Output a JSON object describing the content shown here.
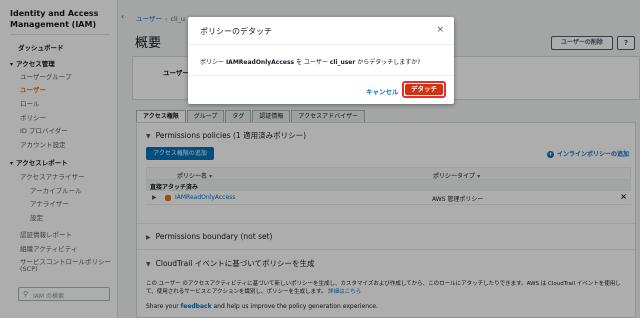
{
  "sidebar": {
    "title_line1": "Identity and Access",
    "title_line2": "Management (IAM)",
    "dashboard": "ダッシュボード",
    "access_mgmt": "アクセス管理",
    "items": [
      "ユーザーグループ",
      "ユーザー",
      "ロール",
      "ポリシー",
      "ID プロバイダー",
      "アカウント設定"
    ],
    "access_reports": "アクセスレポート",
    "reports": [
      "アクセスアナライザー",
      "アーカイブルール",
      "アナライザー",
      "設定"
    ],
    "bottom": [
      "認証情報レポート",
      "組織アクティビティ",
      "サービスコントロールポリシー",
      "(SCP)"
    ],
    "search_placeholder": "IAM の検索"
  },
  "breadcrumb": {
    "item1": "ユーザー",
    "item2": "cli_u"
  },
  "page": {
    "title": "概要",
    "delete_user": "ユーザーの削除",
    "summary_label": "ユーザー"
  },
  "tabs": [
    "アクセス権限",
    "グループ",
    "タグ",
    "認証情報",
    "アクセスアドバイザー"
  ],
  "permissions": {
    "heading": "Permissions policies (1 適用済みポリシー)",
    "add_button": "アクセス権限の追加",
    "inline_add": "インラインポリシーの追加",
    "col_policy": "ポリシー名 ▾",
    "col_type": "ポリシータイプ ▾",
    "group": "直接アタッチ済み",
    "rows": [
      {
        "name": "IAMReadOnlyAccess",
        "type": "AWS 管理ポリシー"
      }
    ]
  },
  "boundary": {
    "heading": "Permissions boundary (not set)"
  },
  "cloudtrail": {
    "heading": "CloudTrail イベントに基づいてポリシーを生成",
    "text": "この ユーザー のアクセスアクティビティに基づいて新しいポリシーを生成し、カスタマイズおよび作成してから、このロールにアタッチしたりできます。AWS は CloudTrail イベントを使用して、使用されるサービスとアクションを識別し、ポリシーを生成します。",
    "link": "詳細はこちら"
  },
  "feedback": {
    "pre": "Share your",
    "link": "feedback",
    "post": "and help us improve the policy generation experience."
  },
  "modal": {
    "title": "ポリシーのデタッチ",
    "body_pre": "ポリシー",
    "policy": "IAMReadOnlyAccess",
    "body_mid": "を ユーザー",
    "user": "cli_user",
    "body_post": "からデタッチしますか?",
    "cancel": "キャンセル",
    "detach": "デタッチ"
  },
  "colors": {
    "accent": "#ec7211",
    "link": "#0073bb",
    "danger": "#d13212"
  }
}
